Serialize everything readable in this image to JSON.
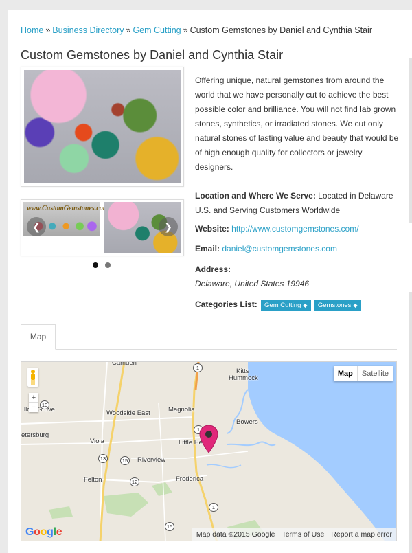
{
  "breadcrumb": {
    "home": "Home",
    "directory": "Business Directory",
    "category": "Gem Cutting",
    "current": "Custom Gemstones by Daniel and Cynthia Stair",
    "separator": "»"
  },
  "listing": {
    "title": "Custom Gemstones by Daniel and Cynthia Stair",
    "description": "Offering unique, natural gemstones from around the world that we have personally cut to achieve the best possible color and brilliance. You will not find lab grown stones, synthetics, or irradiated stones. We cut only natural stones of lasting value and beauty that would be of high enough quality for collectors or jewelry designers.",
    "location_label": "Location and Where We Serve:",
    "location_value": "Located in Delaware U.S. and Serving Customers Worldwide",
    "website_label": "Website:",
    "website_value": "http://www.customgemstones.com/",
    "email_label": "Email:",
    "email_value": "daniel@customgemstones.com",
    "address_label": "Address:",
    "address_value": "Delaware, United States 19946",
    "categories_label": "Categories List:",
    "categories": [
      "Gem Cutting",
      "Gemstones"
    ]
  },
  "gallery": {
    "thumb1_text": "www.CustomGemstones.com",
    "prev_icon": "chevron-left-icon",
    "next_icon": "chevron-right-icon",
    "dots": [
      {
        "active": true
      },
      {
        "active": false
      }
    ]
  },
  "tabs": [
    {
      "label": "Map"
    }
  ],
  "map": {
    "type_buttons": {
      "map": "Map",
      "satellite": "Satellite"
    },
    "zoom_in": "+",
    "zoom_out": "−",
    "places": {
      "camden": "Camden",
      "kitts": "Kitts",
      "hummock": "Hummock",
      "willow_grove": "llow Grove",
      "woodside_east": "Woodside East",
      "magnolia": "Magnolia",
      "bowers": "Bowers",
      "petersburg": "etersburg",
      "viola": "Viola",
      "little_heaven": "Little Heaven",
      "riverview": "Riverview",
      "felton": "Felton",
      "frederica": "Frederica"
    },
    "routes": {
      "r1a": "1",
      "r1b": "1",
      "r1c": "1",
      "r10": "10",
      "r13": "13",
      "r15a": "15",
      "r15b": "15",
      "r12": "12"
    },
    "google": "Google",
    "data_credit": "Map data ©2015 Google",
    "terms": "Terms of Use",
    "report": "Report a map error",
    "colors": {
      "water": "#a3ccff",
      "land": "#ece8df",
      "highway": "#f5d26b",
      "pin": "#e0287a"
    }
  }
}
